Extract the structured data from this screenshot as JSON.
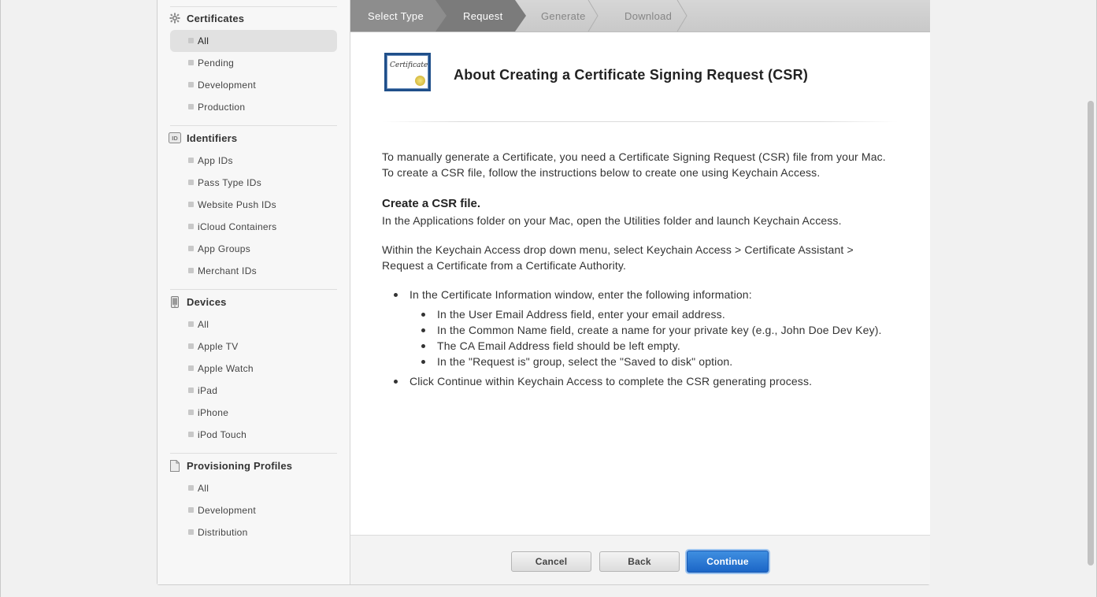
{
  "sidebar": {
    "sections": [
      {
        "label": "Certificates",
        "icon": "gear-icon",
        "items": [
          "All",
          "Pending",
          "Development",
          "Production"
        ],
        "selected": "All"
      },
      {
        "label": "Identifiers",
        "icon": "id-badge-icon",
        "icon_text": "ID",
        "items": [
          "App IDs",
          "Pass Type IDs",
          "Website Push IDs",
          "iCloud Containers",
          "App Groups",
          "Merchant IDs"
        ]
      },
      {
        "label": "Devices",
        "icon": "phone-icon",
        "items": [
          "All",
          "Apple TV",
          "Apple Watch",
          "iPad",
          "iPhone",
          "iPod Touch"
        ]
      },
      {
        "label": "Provisioning Profiles",
        "icon": "document-icon",
        "items": [
          "All",
          "Development",
          "Distribution"
        ]
      }
    ]
  },
  "steps": [
    {
      "label": "Select Type",
      "state": "done"
    },
    {
      "label": "Request",
      "state": "active"
    },
    {
      "label": "Generate",
      "state": "todo"
    },
    {
      "label": "Download",
      "state": "todo"
    }
  ],
  "content": {
    "icon_caption": "Certificate",
    "title": "About Creating a Certificate Signing Request (CSR)",
    "intro": "To manually generate a Certificate, you need a Certificate Signing Request (CSR) file from your Mac. To create a CSR file, follow the instructions below to create one using Keychain Access.",
    "csr_heading": "Create a CSR file.",
    "csr_line": "In the Applications folder on your Mac, open the Utilities folder and launch Keychain Access.",
    "menu_line": "Within the Keychain Access drop down menu, select Keychain Access > Certificate Assistant > Request a Certificate from a Certificate Authority.",
    "bullets": [
      {
        "text": "In the Certificate Information window, enter the following information:",
        "sub": [
          "In the User Email Address field, enter your email address.",
          "In the Common Name field, create a name for your private key (e.g., John Doe Dev Key).",
          "The CA Email Address field should be left empty.",
          "In the \"Request is\" group, select the \"Saved to disk\" option."
        ]
      },
      {
        "text": "Click Continue within Keychain Access to complete the CSR generating process.",
        "sub": []
      }
    ]
  },
  "footer": {
    "cancel_label": "Cancel",
    "back_label": "Back",
    "continue_label": "Continue"
  },
  "colors": {
    "step_done": "#8d8d8d",
    "step_active": "#7b7b7b",
    "primary_button": "#2473d4",
    "selected_nav": "#e1e1e1"
  }
}
